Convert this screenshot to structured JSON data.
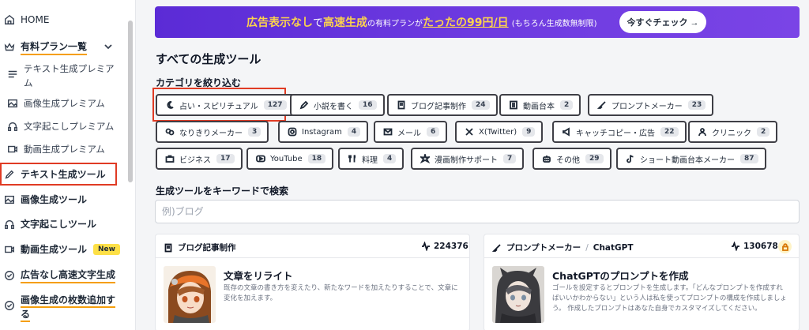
{
  "sidebar": {
    "home": "HOME",
    "plans": "有料プラン一覧",
    "sub_items": [
      "テキスト生成プレミアム",
      "画像生成プレミアム",
      "文字起こしプレミアム",
      "動画生成プレミアム"
    ],
    "sub_items_wrap": [
      "テキスト生成プレミア",
      "ム"
    ],
    "text_tool": "テキスト生成ツール",
    "image_tool": "画像生成ツール",
    "transcribe_tool": "文字起こしツール",
    "video_tool": "動画生成ツール",
    "new_badge": "New",
    "adfree": "広告なし高速文字生成",
    "add_images_1": "画像生成の枚数追加す",
    "add_images_2": "る"
  },
  "banner": {
    "part1": "広告表示なし",
    "part2": "で",
    "part3": "高速生成",
    "part4": "の有料プランが",
    "part5": "たったの99円/日",
    "part6": "(もちろん生成数無制限)",
    "button": "今すぐチェック →"
  },
  "main": {
    "title": "すべての生成ツール",
    "filter_label": "カテゴリを絞り込む",
    "search_label": "生成ツールをキーワードで検索",
    "search_placeholder": "例)ブログ"
  },
  "categories": [
    {
      "label": "占い・スピリチュアル",
      "count": "127",
      "icon": "moon-icon"
    },
    {
      "label": "小説を書く",
      "count": "16",
      "icon": "pen-icon"
    },
    {
      "label": "ブログ記事制作",
      "count": "24",
      "icon": "book-icon"
    },
    {
      "label": "動画台本",
      "count": "2",
      "icon": "list-icon"
    },
    {
      "label": "プロンプトメーカー",
      "count": "23",
      "icon": "brush-icon"
    },
    {
      "label": "なりきりメーカー",
      "count": "3",
      "icon": "masks-icon"
    },
    {
      "label": "Instagram",
      "count": "4",
      "icon": "instagram-icon"
    },
    {
      "label": "メール",
      "count": "6",
      "icon": "mail-icon"
    },
    {
      "label": "X(Twitter)",
      "count": "9",
      "icon": "x-icon"
    },
    {
      "label": "キャッチコピー・広告",
      "count": "22",
      "icon": "megaphone-icon"
    },
    {
      "label": "クリニック",
      "count": "2",
      "icon": "doctor-icon"
    },
    {
      "label": "ビジネス",
      "count": "17",
      "icon": "briefcase-icon"
    },
    {
      "label": "YouTube",
      "count": "18",
      "icon": "youtube-icon"
    },
    {
      "label": "料理",
      "count": "4",
      "icon": "utensils-icon"
    },
    {
      "label": "漫画制作サポート",
      "count": "7",
      "icon": "burst-icon"
    },
    {
      "label": "その他",
      "count": "29",
      "icon": "robot-icon"
    },
    {
      "label": "ショート動画台本メーカー",
      "count": "87",
      "icon": "tiktok-icon"
    }
  ],
  "cards": [
    {
      "category": "ブログ記事制作",
      "uses": "224376",
      "title": "文章をリライト",
      "desc1": "既存の文章の書き方を変えたり、新たなワードを加えたりすることで、文章に",
      "desc2": "変化を加えます。"
    },
    {
      "category": "プロンプトメーカー",
      "category_sub": "ChatGPT",
      "uses": "130678",
      "title": "ChatGPTのプロンプトを作成",
      "desc1": "ゴールを設定するとプロンプトを生成します。「どんなプロンプトを作成すれ",
      "desc2": "ばいいかわからない」という人は私を使ってプロンプトの構成を作成しましょ",
      "desc3": "う。 作成したプロンプトはあなた自身でカスタマイズしてください。"
    }
  ],
  "colors": {
    "accent_red": "#e03b24",
    "banner": "#6d3ae0",
    "highlight_yellow": "#fcd34d",
    "underline": "#f59e0b"
  }
}
